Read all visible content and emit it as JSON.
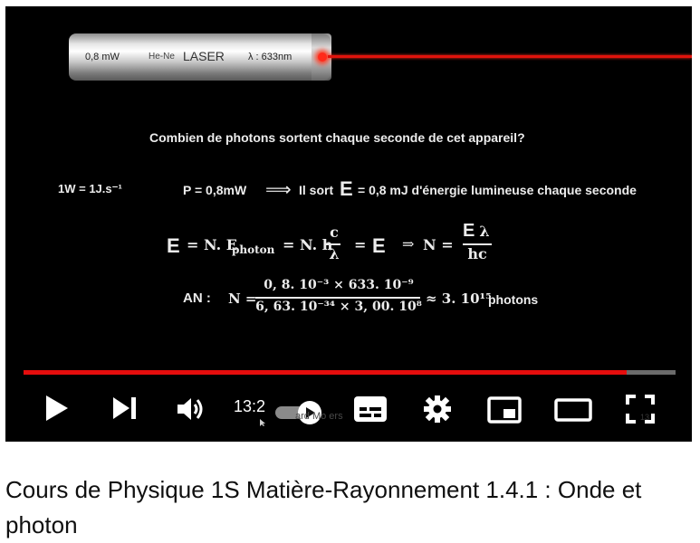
{
  "laser": {
    "power": "0,8 mW",
    "type": "He-Ne",
    "name": "LASER",
    "wavelength": "λ : 633nm"
  },
  "slide": {
    "question": "Combien de photons sortent chaque seconde de cet appareil?",
    "unit_def": "1W = 1J.s⁻¹",
    "power_line": "P = 0,8mW",
    "arrow": "⟹",
    "sort_pre": "Il sort",
    "energy_symbol": "E",
    "sort_post": "= 0,8 mJ d'énergie lumineuse chaque seconde",
    "eq_part1": "= N. E",
    "eq_sub": "photon",
    "eq_part2": "= N. h",
    "c": "c",
    "lambda": "λ",
    "eq_part3": "=",
    "implies": "⇒",
    "n_eq": "N =",
    "numerator_lambda": "λ",
    "denominator": "hc",
    "an_label": "AN :",
    "an_n": "N =",
    "an_numerator": "0, 8. 10⁻³ × 633. 10⁻⁹",
    "an_denominator": "6, 63. 10⁻³⁴ × 3, 00. 10⁸",
    "an_result": "≈ 3. 10¹⁵",
    "an_unit": "photons"
  },
  "player": {
    "progress": 0.925,
    "time": "13:2",
    "overlay_text": "ard Mo  ers",
    "right_edge_text": "13",
    "icons": {
      "play": "play-icon",
      "next": "next-icon",
      "volume": "volume-icon",
      "autoplay": "autoplay-toggle",
      "subtitles": "subtitles-icon",
      "settings": "gear-icon",
      "miniplayer": "miniplayer-icon",
      "theater": "theater-icon",
      "fullscreen": "fullscreen-icon"
    },
    "colors": {
      "progress": "#e50d0d",
      "track": "#6b6b6b",
      "beam": "#e0130c"
    }
  },
  "video": {
    "title": "Cours de Physique 1S Matière-Rayonnement 1.4.1 : Onde et photon"
  }
}
